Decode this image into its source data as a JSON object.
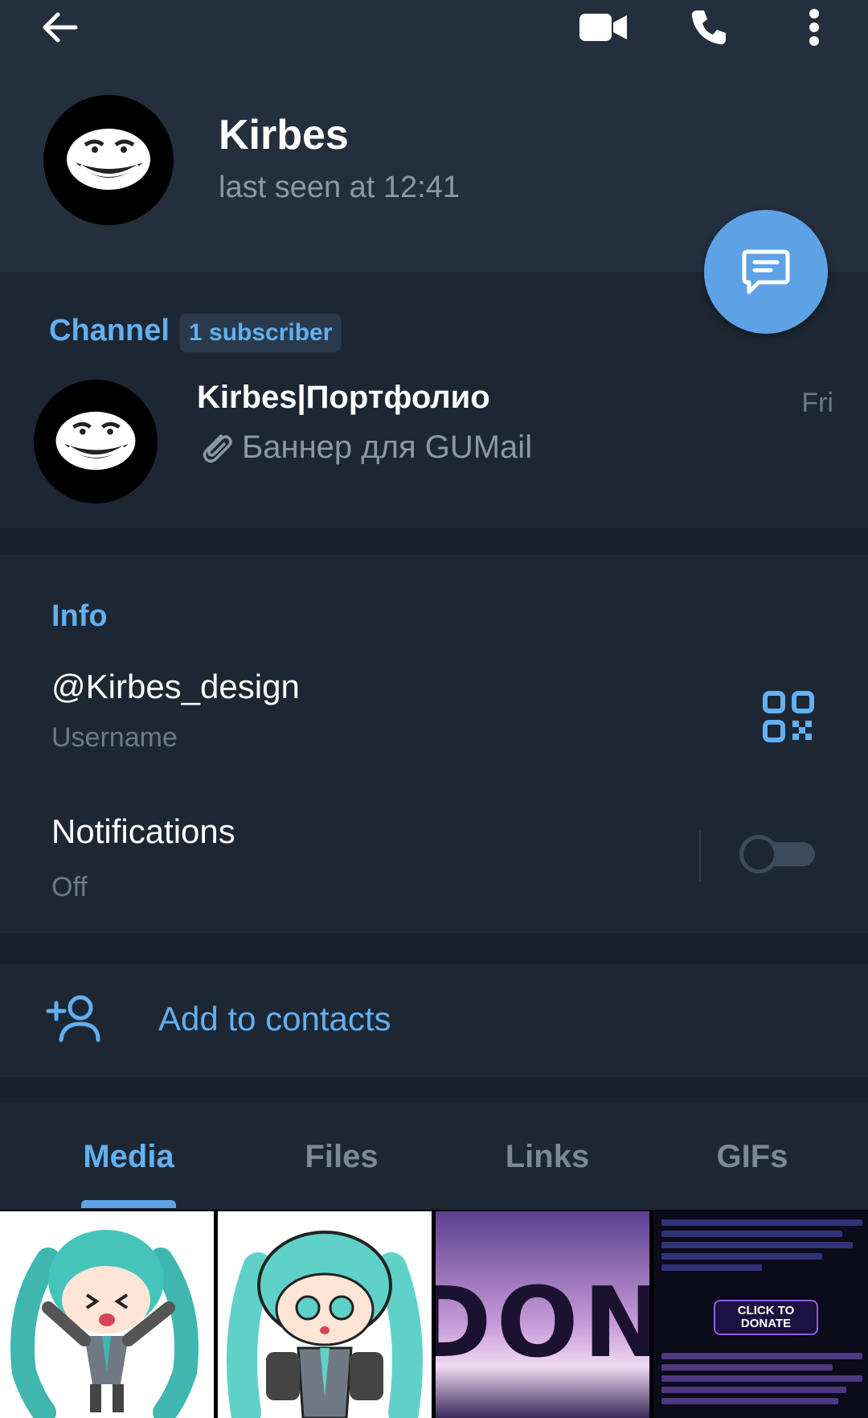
{
  "topbar": {
    "back_icon": "arrow-left-icon",
    "video_icon": "video-camera-icon",
    "call_icon": "phone-icon",
    "more_icon": "more-vertical-icon"
  },
  "profile": {
    "name": "Kirbes",
    "status": "last seen at 12:41",
    "fab_icon": "message-icon"
  },
  "channel": {
    "heading": "Channel",
    "badge": "1 subscriber",
    "title": "Kirbes|Портфолио",
    "message": "Баннер для GUMail",
    "date": "Fri"
  },
  "info": {
    "heading": "Info",
    "username": "@Kirbes_design",
    "username_label": "Username",
    "notifications_label": "Notifications",
    "notifications_value": "Off"
  },
  "contacts": {
    "add_label": "Add to contacts"
  },
  "tabs": {
    "items": [
      "Media",
      "Files",
      "Links",
      "GIFs"
    ],
    "active": "Media"
  },
  "media": {
    "tile3_button_line1": "CLICK TO",
    "tile3_button_line2": "DONATE",
    "tile2_text": "DONA"
  },
  "colors": {
    "background": "#1d2733",
    "header": "#242f3d",
    "accent": "#63aff0",
    "fab": "#5ea2e6"
  }
}
